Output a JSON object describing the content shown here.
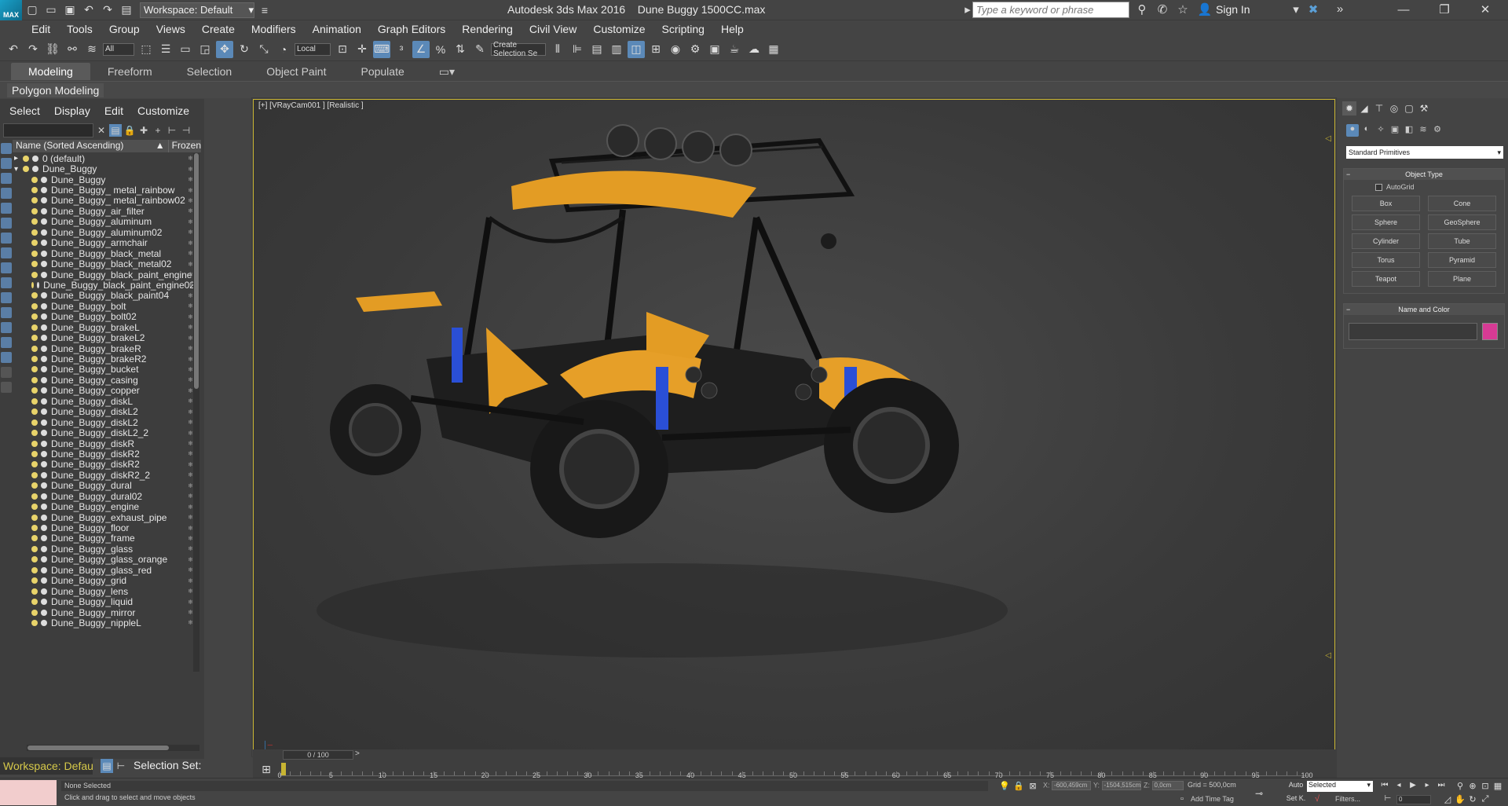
{
  "titlebar": {
    "workspace": "Workspace: Default",
    "app_title": "Autodesk 3ds Max 2016",
    "file_name": "Dune Buggy 1500CC.max",
    "search_placeholder": "Type a keyword or phrase",
    "sign_in": "Sign In"
  },
  "menu": [
    "Edit",
    "Tools",
    "Group",
    "Views",
    "Create",
    "Modifiers",
    "Animation",
    "Graph Editors",
    "Rendering",
    "Civil View",
    "Customize",
    "Scripting",
    "Help"
  ],
  "toolbar": {
    "filter_value": "All",
    "coord_system": "Local",
    "named_selection": "Create Selection Se"
  },
  "ribbon": {
    "tabs": [
      "Modeling",
      "Freeform",
      "Selection",
      "Object Paint",
      "Populate"
    ],
    "active_tab": "Modeling",
    "panel": "Polygon Modeling"
  },
  "explorer": {
    "menu": [
      "Select",
      "Display",
      "Edit",
      "Customize"
    ],
    "col_name": "Name (Sorted Ascending)",
    "col_sort_indicator": "▲",
    "col_frozen": "Frozen",
    "rows": [
      {
        "label": "0 (default)",
        "level": 0
      },
      {
        "label": "Dune_Buggy",
        "level": 0
      },
      {
        "label": "Dune_Buggy",
        "level": 1
      },
      {
        "label": "Dune_Buggy_ metal_rainbow",
        "level": 1
      },
      {
        "label": "Dune_Buggy_ metal_rainbow02",
        "level": 1
      },
      {
        "label": "Dune_Buggy_air_filter",
        "level": 1
      },
      {
        "label": "Dune_Buggy_aluminum",
        "level": 1
      },
      {
        "label": "Dune_Buggy_aluminum02",
        "level": 1
      },
      {
        "label": "Dune_Buggy_armchair",
        "level": 1
      },
      {
        "label": "Dune_Buggy_black_metal",
        "level": 1
      },
      {
        "label": "Dune_Buggy_black_metal02",
        "level": 1
      },
      {
        "label": "Dune_Buggy_black_paint_engine",
        "level": 1
      },
      {
        "label": "Dune_Buggy_black_paint_engine02",
        "level": 1
      },
      {
        "label": "Dune_Buggy_black_paint04",
        "level": 1
      },
      {
        "label": "Dune_Buggy_bolt",
        "level": 1
      },
      {
        "label": "Dune_Buggy_bolt02",
        "level": 1
      },
      {
        "label": "Dune_Buggy_brakeL",
        "level": 1
      },
      {
        "label": "Dune_Buggy_brakeL2",
        "level": 1
      },
      {
        "label": "Dune_Buggy_brakeR",
        "level": 1
      },
      {
        "label": "Dune_Buggy_brakeR2",
        "level": 1
      },
      {
        "label": "Dune_Buggy_bucket",
        "level": 1
      },
      {
        "label": "Dune_Buggy_casing",
        "level": 1
      },
      {
        "label": "Dune_Buggy_copper",
        "level": 1
      },
      {
        "label": "Dune_Buggy_diskL",
        "level": 1
      },
      {
        "label": "Dune_Buggy_diskL2",
        "level": 1
      },
      {
        "label": "Dune_Buggy_diskL2",
        "level": 1
      },
      {
        "label": "Dune_Buggy_diskL2_2",
        "level": 1
      },
      {
        "label": "Dune_Buggy_diskR",
        "level": 1
      },
      {
        "label": "Dune_Buggy_diskR2",
        "level": 1
      },
      {
        "label": "Dune_Buggy_diskR2",
        "level": 1
      },
      {
        "label": "Dune_Buggy_diskR2_2",
        "level": 1
      },
      {
        "label": "Dune_Buggy_dural",
        "level": 1
      },
      {
        "label": "Dune_Buggy_dural02",
        "level": 1
      },
      {
        "label": "Dune_Buggy_engine",
        "level": 1
      },
      {
        "label": "Dune_Buggy_exhaust_pipe",
        "level": 1
      },
      {
        "label": "Dune_Buggy_floor",
        "level": 1
      },
      {
        "label": "Dune_Buggy_frame",
        "level": 1
      },
      {
        "label": "Dune_Buggy_glass",
        "level": 1
      },
      {
        "label": "Dune_Buggy_glass_orange",
        "level": 1
      },
      {
        "label": "Dune_Buggy_glass_red",
        "level": 1
      },
      {
        "label": "Dune_Buggy_grid",
        "level": 1
      },
      {
        "label": "Dune_Buggy_lens",
        "level": 1
      },
      {
        "label": "Dune_Buggy_liquid",
        "level": 1
      },
      {
        "label": "Dune_Buggy_mirror",
        "level": 1
      },
      {
        "label": "Dune_Buggy_nippleL",
        "level": 1
      }
    ]
  },
  "viewport": {
    "label": "[+] [VRayCam001 ] [Realistic ]"
  },
  "command_panel": {
    "category": "Standard Primitives",
    "object_type_title": "Object Type",
    "autogrid": "AutoGrid",
    "primitives": [
      "Box",
      "Cone",
      "Sphere",
      "GeoSphere",
      "Cylinder",
      "Tube",
      "Torus",
      "Pyramid",
      "Teapot",
      "Plane"
    ],
    "name_color_title": "Name and Color",
    "object_color": "#d63a94"
  },
  "timeline": {
    "frame_readout": "0 / 100",
    "ticks": [
      "0",
      "5",
      "10",
      "15",
      "20",
      "25",
      "30",
      "35",
      "40",
      "45",
      "50",
      "55",
      "60",
      "65",
      "70",
      "75",
      "80",
      "85",
      "90",
      "95",
      "100"
    ]
  },
  "bottom_left": {
    "workspace": "Workspace: Default",
    "selection_set": "Selection Set:"
  },
  "status": {
    "selection": "None Selected",
    "prompt": "Click and drag to select and move objects",
    "x_label": "X:",
    "x_value": "-600,459cm",
    "y_label": "Y:",
    "y_value": "-1504,515cm",
    "z_label": "Z:",
    "z_value": "0,0cm",
    "grid": "Grid = 500,0cm",
    "add_time_tag": "Add Time Tag",
    "auto": "Auto",
    "set_key": "Set K.",
    "key_filter": "Selected",
    "filters": "Filters...",
    "frame": "0"
  }
}
